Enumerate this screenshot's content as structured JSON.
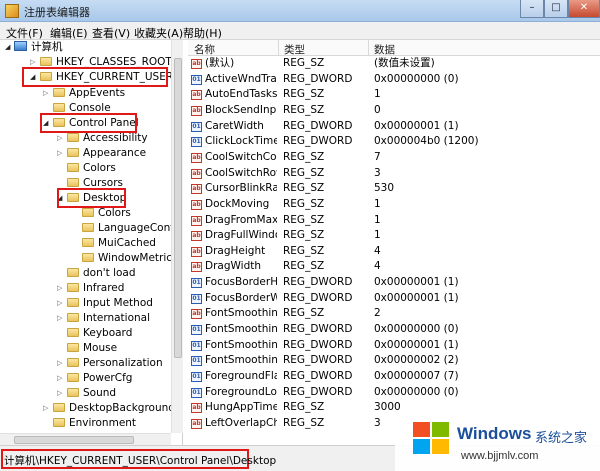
{
  "window": {
    "title": "注册表编辑器",
    "minimize": "–",
    "maximize": "□",
    "close": "✕"
  },
  "menu": [
    "文件(F)",
    "编辑(E)",
    "查看(V)",
    "收藏夹(A)",
    "帮助(H)"
  ],
  "tree": {
    "computer": "计算机",
    "nodes": [
      "HKEY_CLASSES_ROOT",
      "HKEY_CURRENT_USER",
      "AppEvents",
      "Console",
      "Control Panel",
      "Accessibility",
      "Appearance",
      "Colors",
      "Cursors",
      "Desktop",
      "Colors",
      "LanguageConfig",
      "MuiCached",
      "WindowMetrics",
      "don't load",
      "Infrared",
      "Input Method",
      "International",
      "Keyboard",
      "Mouse",
      "Personalization",
      "PowerCfg",
      "Sound",
      "DesktopBackground",
      "Environment"
    ]
  },
  "list": {
    "headers": {
      "name": "名称",
      "type": "类型",
      "data": "数据"
    },
    "rows": [
      {
        "icon": "string-value-icon",
        "name": "(默认)",
        "type": "REG_SZ",
        "data": "(数值未设置)"
      },
      {
        "icon": "dword-value-icon",
        "name": "ActiveWndTrac...",
        "type": "REG_DWORD",
        "data": "0x00000000 (0)"
      },
      {
        "icon": "string-value-icon",
        "name": "AutoEndTasks",
        "type": "REG_SZ",
        "data": "1"
      },
      {
        "icon": "string-value-icon",
        "name": "BlockSendInpu...",
        "type": "REG_SZ",
        "data": "0"
      },
      {
        "icon": "dword-value-icon",
        "name": "CaretWidth",
        "type": "REG_DWORD",
        "data": "0x00000001 (1)"
      },
      {
        "icon": "dword-value-icon",
        "name": "ClickLockTime",
        "type": "REG_DWORD",
        "data": "0x000004b0 (1200)"
      },
      {
        "icon": "string-value-icon",
        "name": "CoolSwitchCol...",
        "type": "REG_SZ",
        "data": "7"
      },
      {
        "icon": "string-value-icon",
        "name": "CoolSwitchRows",
        "type": "REG_SZ",
        "data": "3"
      },
      {
        "icon": "string-value-icon",
        "name": "CursorBlinkRate",
        "type": "REG_SZ",
        "data": "530"
      },
      {
        "icon": "string-value-icon",
        "name": "DockMoving",
        "type": "REG_SZ",
        "data": "1"
      },
      {
        "icon": "string-value-icon",
        "name": "DragFromMaxi...",
        "type": "REG_SZ",
        "data": "1"
      },
      {
        "icon": "string-value-icon",
        "name": "DragFullWindo...",
        "type": "REG_SZ",
        "data": "1"
      },
      {
        "icon": "string-value-icon",
        "name": "DragHeight",
        "type": "REG_SZ",
        "data": "4"
      },
      {
        "icon": "string-value-icon",
        "name": "DragWidth",
        "type": "REG_SZ",
        "data": "4"
      },
      {
        "icon": "dword-value-icon",
        "name": "FocusBorderH...",
        "type": "REG_DWORD",
        "data": "0x00000001 (1)"
      },
      {
        "icon": "dword-value-icon",
        "name": "FocusBorderW...",
        "type": "REG_DWORD",
        "data": "0x00000001 (1)"
      },
      {
        "icon": "string-value-icon",
        "name": "FontSmoothing",
        "type": "REG_SZ",
        "data": "2"
      },
      {
        "icon": "dword-value-icon",
        "name": "FontSmoothin...",
        "type": "REG_DWORD",
        "data": "0x00000000 (0)"
      },
      {
        "icon": "dword-value-icon",
        "name": "FontSmoothin...",
        "type": "REG_DWORD",
        "data": "0x00000001 (1)"
      },
      {
        "icon": "dword-value-icon",
        "name": "FontSmoothin...",
        "type": "REG_DWORD",
        "data": "0x00000002 (2)"
      },
      {
        "icon": "dword-value-icon",
        "name": "ForegroundFla...",
        "type": "REG_DWORD",
        "data": "0x00000007 (7)"
      },
      {
        "icon": "dword-value-icon",
        "name": "ForegroundLo...",
        "type": "REG_DWORD",
        "data": "0x00000000 (0)"
      },
      {
        "icon": "string-value-icon",
        "name": "HungAppTime...",
        "type": "REG_SZ",
        "data": "3000"
      },
      {
        "icon": "string-value-icon",
        "name": "LeftOverlapCh...",
        "type": "REG_SZ",
        "data": "3"
      }
    ]
  },
  "status": {
    "path": "计算机\\HKEY_CURRENT_USER\\Control Panel\\Desktop"
  },
  "watermark": {
    "brand": "Windows",
    "brand_cn": "系统之家",
    "url": "www.bjjmlv.com"
  },
  "colors": {
    "highlight": "#e01818",
    "titlebar": "#b8d2ee",
    "brand": "#1a4f9c"
  }
}
